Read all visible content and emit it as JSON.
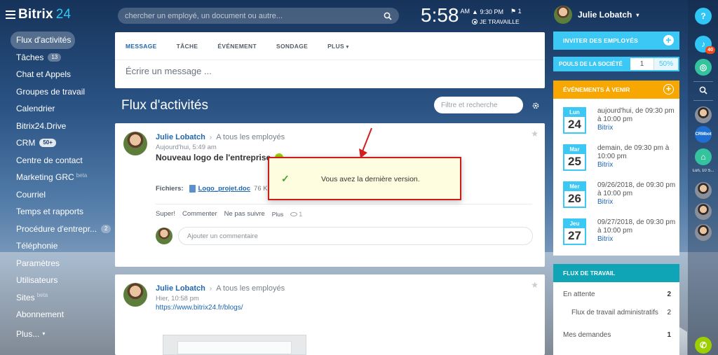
{
  "brand": {
    "name": "Bitrix",
    "num": "24"
  },
  "sidebar": {
    "items": [
      {
        "label": "Flux d'activités",
        "active": true
      },
      {
        "label": "Tâches",
        "badge": "13"
      },
      {
        "label": "Chat et Appels"
      },
      {
        "label": "Groupes de travail"
      },
      {
        "label": "Calendrier"
      },
      {
        "label": "Bitrix24.Drive"
      },
      {
        "label": "CRM",
        "badge": "50+"
      },
      {
        "label": "Centre de contact"
      },
      {
        "label": "Marketing GRC",
        "sup": "beta"
      },
      {
        "label": "Courriel"
      },
      {
        "label": "Temps et rapports"
      },
      {
        "label": "Procédure d'entrepr...",
        "badge": "2"
      },
      {
        "label": "Téléphonie"
      },
      {
        "label": "Paramètres"
      },
      {
        "label": "Utilisateurs"
      },
      {
        "label": "Sites",
        "sup": "beta"
      },
      {
        "label": "Abonnement"
      },
      {
        "label": "Plus...",
        "arrow": "▾"
      }
    ]
  },
  "header": {
    "search_placeholder": "chercher un employé, un document ou autre...",
    "clock": {
      "time": "5:58",
      "ampm": "AM",
      "alarm": "9:30 PM",
      "flag_count": "1",
      "status": "JE TRAVAILLE"
    },
    "user_name": "Julie Lobatch"
  },
  "composer": {
    "tabs": [
      "MESSAGE",
      "TÂCHE",
      "ÉVÉNEMENT",
      "SONDAGE",
      "PLUS"
    ],
    "placeholder": "Écrire un message ..."
  },
  "feed": {
    "title": "Flux d'activités",
    "filter_placeholder": "Filtre et recherche",
    "posts": [
      {
        "author": "Julie Lobatch",
        "destination": "A tous les employés",
        "date": "Aujourd'hui, 5:49 am",
        "title": "Nouveau logo de l'entreprise",
        "files_label": "Fichiers:",
        "file_name": "Logo_projet.doc",
        "file_size": "76 Kb",
        "actions": {
          "like": "Super!",
          "comment": "Commenter",
          "unfollow": "Ne pas suivre",
          "more": "Plus",
          "views": "1"
        },
        "comment_placeholder": "Ajouter un commentaire"
      },
      {
        "author": "Julie Lobatch",
        "destination": "A tous les employés",
        "date": "Hier, 10:58 pm",
        "link": "https://www.bitrix24.fr/blogs/"
      }
    ]
  },
  "notification": {
    "text": "Vous avez la dernière version."
  },
  "right": {
    "invite_label": "INVITER DES EMPLOYÉS",
    "pouls": {
      "label": "POULS DE LA SOCIÉTÉ",
      "value": "1",
      "percent": "50%"
    },
    "events_title": "ÉVÉNEMENTS À VENIR",
    "events": [
      {
        "month": "Lun",
        "day": "24",
        "text": "aujourd'hui, de 09:30 pm à 10:00 pm",
        "link": "Bitrix"
      },
      {
        "month": "Mar",
        "day": "25",
        "text": "demain, de 09:30 pm à 10:00 pm",
        "link": "Bitrix"
      },
      {
        "month": "Mer",
        "day": "26",
        "text": "09/26/2018, de 09:30 pm à 10:00 pm",
        "link": "Bitrix"
      },
      {
        "month": "Jeu",
        "day": "27",
        "text": "09/27/2018, de 09:30 pm à 10:00 pm",
        "link": "Bitrix"
      }
    ],
    "workflow_title": "FLUX DE TRAVAIL",
    "workflow": [
      {
        "label": "En attente",
        "count": "2"
      },
      {
        "label": "Flux de travail administratifs",
        "count": "2"
      },
      {
        "label": "Mes demandes",
        "count": "1"
      }
    ]
  },
  "rightbar": {
    "help": "?",
    "notifications_badge": "40",
    "crm_label": "CRMbot",
    "caption": "Lun, 10 S..."
  },
  "colors": {
    "accent": "#3bc8f5",
    "orange": "#f7a700",
    "teal": "#0fa5b6",
    "link": "#2067b0",
    "alert_border": "#cc1d1d"
  }
}
